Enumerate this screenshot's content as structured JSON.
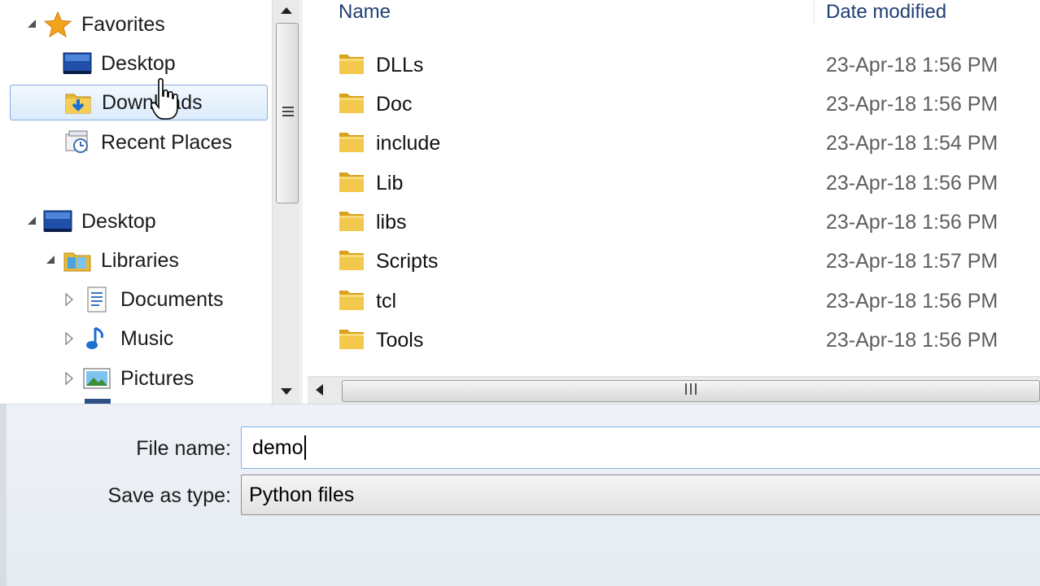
{
  "nav": {
    "favorites": "Favorites",
    "fav_items": [
      "Desktop",
      "Downloads",
      "Recent Places"
    ],
    "desktop": "Desktop",
    "libraries": "Libraries",
    "lib_items": [
      "Documents",
      "Music",
      "Pictures"
    ]
  },
  "columns": {
    "name": "Name",
    "date": "Date modified"
  },
  "files": [
    {
      "name": "DLLs",
      "date": "23-Apr-18 1:56 PM"
    },
    {
      "name": "Doc",
      "date": "23-Apr-18 1:56 PM"
    },
    {
      "name": "include",
      "date": "23-Apr-18 1:54 PM"
    },
    {
      "name": "Lib",
      "date": "23-Apr-18 1:56 PM"
    },
    {
      "name": "libs",
      "date": "23-Apr-18 1:56 PM"
    },
    {
      "name": "Scripts",
      "date": "23-Apr-18 1:57 PM"
    },
    {
      "name": "tcl",
      "date": "23-Apr-18 1:56 PM"
    },
    {
      "name": "Tools",
      "date": "23-Apr-18 1:56 PM"
    }
  ],
  "form": {
    "filename_label": "File name:",
    "filename_value": "demo",
    "savetype_label": "Save as type:",
    "savetype_value": "Python files"
  },
  "colors": {
    "selection_border": "#84acdd",
    "header_text": "#1e3f73",
    "folder": "#e8b934"
  }
}
